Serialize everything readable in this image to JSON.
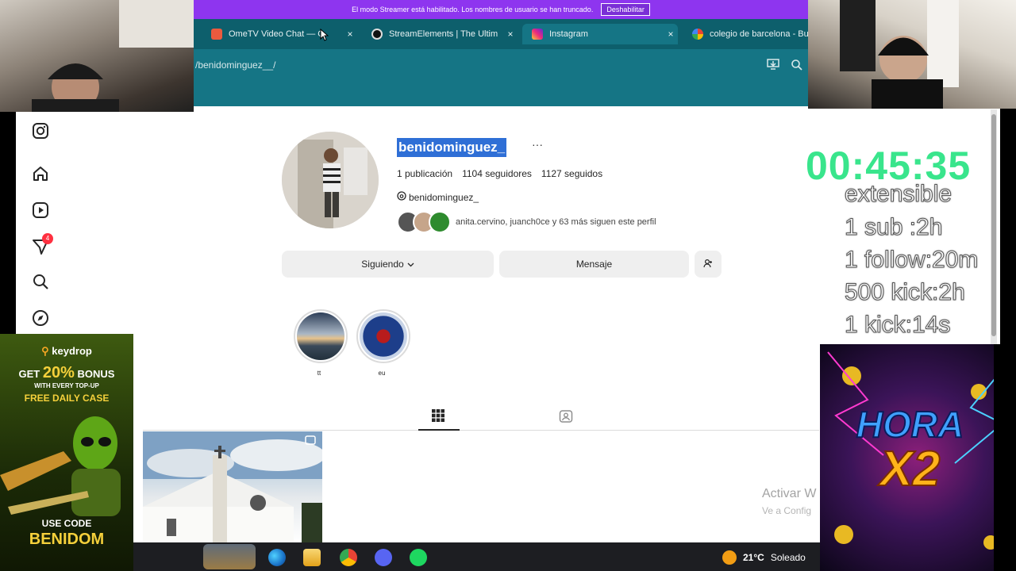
{
  "streamer_notice": {
    "text": "El modo Streamer está habilitado. Los nombres de usuario se han truncado.",
    "disable_label": "Deshabilitar"
  },
  "tabs": [
    {
      "title": "OmeTV Video Chat — O",
      "close": "×",
      "icon": "ometv-icon"
    },
    {
      "title": "StreamElements | The Ultim",
      "close": "×",
      "icon": "streamelements-icon"
    },
    {
      "title": "Instagram",
      "close": "×",
      "icon": "instagram-icon",
      "active": true
    },
    {
      "title": "colegio de barcelona - Bus",
      "close": "×",
      "icon": "google-icon"
    }
  ],
  "address": {
    "url": "/benidominguez__/"
  },
  "profile": {
    "username": "benidominguez_",
    "more": "···",
    "stats": {
      "posts": "1 publicación",
      "followers": "1104 seguidores",
      "following": "1127 seguidos"
    },
    "threads_handle": "benidominguez_",
    "followed_by": "anita.cervino, juanch0ce y 63 más siguen este perfil"
  },
  "buttons": {
    "following": "Siguiendo",
    "message": "Mensaje"
  },
  "notifications_badge": "4",
  "highlights": [
    {
      "label": "tt"
    },
    {
      "label": "eu"
    }
  ],
  "windows_watermark": {
    "title": "Activar W",
    "subtitle": "Ve a Config"
  },
  "taskbar": {
    "weather_temp": "21°C",
    "weather_text": "Soleado"
  },
  "overlays": {
    "timer": "00:45:35",
    "lines": [
      "extensible",
      "1 sub :2h",
      "1 follow:20m",
      "500 kick:2h",
      "1 kick:14s"
    ],
    "keydrop": {
      "brand": "keydrop",
      "bonus_get": "GET",
      "bonus_pct": "20%",
      "bonus_word": "BONUS",
      "with_every": "WITH EVERY TOP-UP",
      "free_case": "FREE DAILY CASE",
      "use_code": "USE CODE",
      "code": "BENIDOM"
    },
    "hora": {
      "line1": "HORA",
      "line2": "X2"
    }
  },
  "colors": {
    "streamer_bar": "#8e35ef",
    "browser_teal": "#157585",
    "timer_green": "#39e58c",
    "instagram_blue": "#2f6fd6"
  }
}
